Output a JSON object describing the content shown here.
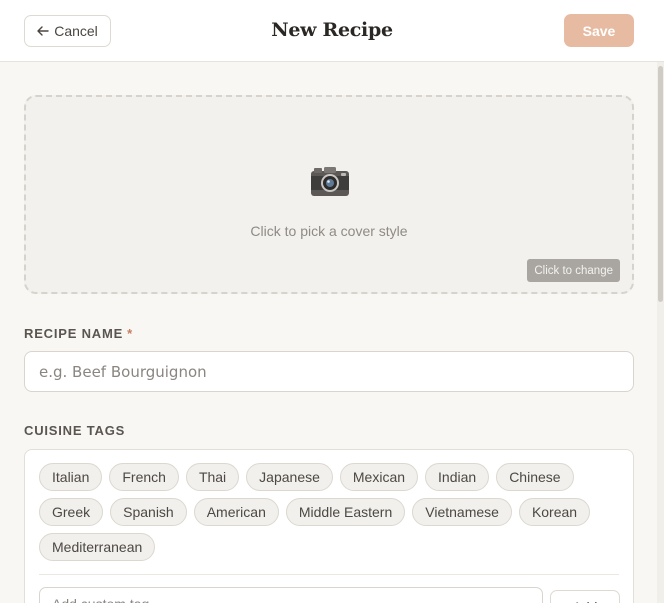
{
  "header": {
    "cancel_label": "Cancel",
    "cancel_icon": "arrow-left-icon",
    "title": "New Recipe",
    "save_label": "Save"
  },
  "cover": {
    "icon": "camera-icon",
    "prompt": "Click to pick a cover style",
    "change_label": "Click to change"
  },
  "recipe_name": {
    "label": "RECIPE NAME",
    "required_mark": "*",
    "placeholder": "e.g. Beef Bourguignon",
    "value": ""
  },
  "cuisine_tags": {
    "label": "CUISINE TAGS",
    "tags": [
      "Italian",
      "French",
      "Thai",
      "Japanese",
      "Mexican",
      "Indian",
      "Chinese",
      "Greek",
      "Spanish",
      "American",
      "Middle Eastern",
      "Vietnamese",
      "Korean",
      "Mediterranean"
    ],
    "input_placeholder": "Add custom tag",
    "add_label": "Add"
  },
  "colors": {
    "accent": "#e7bba2",
    "required": "#c97c5d",
    "background": "#f8f7f3"
  }
}
